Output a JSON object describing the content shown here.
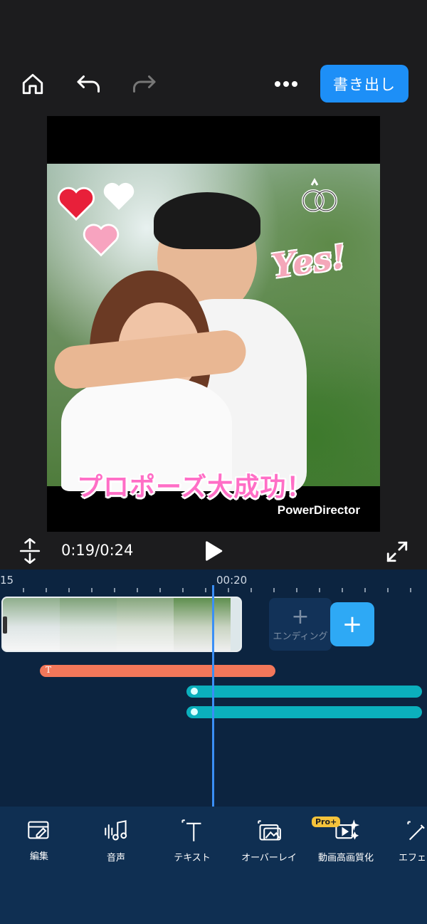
{
  "topbar": {
    "home_icon": "home-icon",
    "undo_icon": "undo-icon",
    "redo_icon": "redo-icon",
    "more_icon": "more-icon",
    "export_label": "書き出し"
  },
  "preview": {
    "caption": "プロポーズ大成功！",
    "sticker_text": "Yes!",
    "watermark": "PowerDirector"
  },
  "playback": {
    "time": "0:19/0:24",
    "play_icon": "play-icon",
    "fullscreen_icon": "fullscreen-icon",
    "resize_icon": "resize-vertical-icon"
  },
  "timeline": {
    "ruler_left_label": "15",
    "ruler_mark_label": "00:20",
    "ending_label": "エンディング",
    "ending_plus": "+",
    "add_label": "+",
    "text_track_icon": "T"
  },
  "toolbar": {
    "items": [
      {
        "label": "編集",
        "icon": "edit-icon"
      },
      {
        "label": "音声",
        "icon": "audio-icon"
      },
      {
        "label": "テキスト",
        "icon": "text-icon"
      },
      {
        "label": "オーバーレイ",
        "icon": "overlay-icon"
      },
      {
        "label": "動画高画質化",
        "icon": "video-enhance-icon",
        "badge": "Pro+"
      },
      {
        "label": "エフェ",
        "icon": "effect-icon"
      }
    ]
  },
  "colors": {
    "accent": "#1d8ff7",
    "text_track": "#f2775a",
    "sticker_track": "#0bb0bd"
  }
}
